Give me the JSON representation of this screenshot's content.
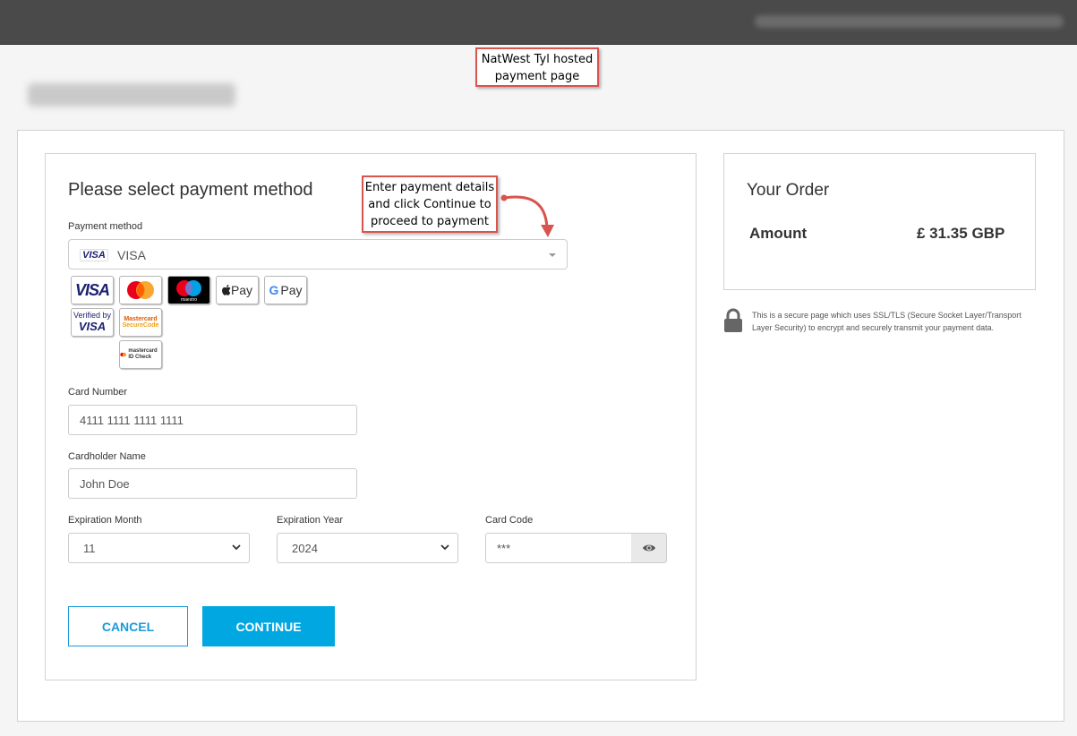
{
  "annotations": {
    "hosted_page": "NatWest Tyl hosted payment page",
    "instructions": "Enter payment details and click Continue to proceed to payment"
  },
  "payment": {
    "title": "Please select payment method",
    "method_label": "Payment method",
    "method_value": "VISA",
    "method_icon": "visa-icon",
    "brands": [
      "visa-icon",
      "mastercard-icon",
      "maestro-icon",
      "apple-pay-icon",
      "google-pay-icon",
      "verified-by-visa-icon",
      "mastercard-securecode-icon",
      "mastercard-id-check-icon"
    ],
    "brand_text": {
      "visa": "VISA",
      "apple_pay": "Pay",
      "google_pay": "Pay",
      "vbv_small": "Verified by",
      "vbv_big": "VISA",
      "mcsc_a": "Mastercard",
      "mcsc_b": "SecureCode",
      "idcheck": "mastercard ID Check",
      "maestro": "maestro"
    },
    "card_number_label": "Card Number",
    "card_number_value": "4111 1111 1111 1111",
    "cardholder_label": "Cardholder Name",
    "cardholder_value": "John Doe",
    "exp_month_label": "Expiration Month",
    "exp_month_value": "11",
    "exp_year_label": "Expiration Year",
    "exp_year_value": "2024",
    "card_code_label": "Card Code",
    "card_code_value": "***",
    "cancel_label": "CANCEL",
    "continue_label": "CONTINUE"
  },
  "order": {
    "title": "Your Order",
    "amount_label": "Amount",
    "amount_value": "£ 31.35 GBP",
    "secure_text": "This is a secure page which uses SSL/TLS (Secure Socket Layer/Transport Layer Security) to encrypt and securely transmit your payment data."
  },
  "colors": {
    "accent": "#00a7e1",
    "cancel_border": "#1a9bd7",
    "callout_border": "#d9534f",
    "topbar": "#4a4a4a"
  }
}
